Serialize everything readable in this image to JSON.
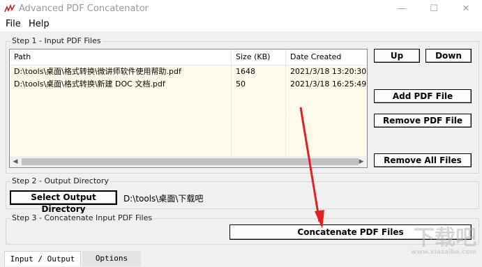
{
  "window": {
    "title": "Advanced PDF Concatenator",
    "minimize": "—",
    "maximize": "☐",
    "close": "✕"
  },
  "menu": [
    "File",
    "Help"
  ],
  "step1": {
    "title": "Step 1 - Input PDF Files",
    "columns": [
      "Path",
      "Size (KB)",
      "Date Created"
    ],
    "rows": [
      {
        "path": "D:\\tools\\桌面\\格式转换\\微讲师软件使用帮助.pdf",
        "size": "1648",
        "date": "2021/3/18 13:20:30"
      },
      {
        "path": "D:\\tools\\桌面\\格式转换\\新建 DOC 文档.pdf",
        "size": "50",
        "date": "2021/3/18 16:25:49"
      }
    ],
    "buttons": {
      "up": "Up",
      "down": "Down",
      "add": "Add PDF File",
      "remove": "Remove PDF File",
      "remove_all": "Remove All Files"
    }
  },
  "step2": {
    "title": "Step 2 - Output Directory",
    "select_button": "Select Output Directory",
    "directory": "D:\\tools\\桌面\\下载吧"
  },
  "step3": {
    "title": "Step 3 - Concatenate Input PDF Files",
    "button": "Concatenate PDF Files"
  },
  "tabs": [
    "Input / Output",
    "Options"
  ],
  "watermark": {
    "main": "下载吧",
    "sub": "www.xiazaiba.com"
  },
  "colors": {
    "annotation_arrow": "#e02020",
    "list_background": "#fefbea"
  }
}
